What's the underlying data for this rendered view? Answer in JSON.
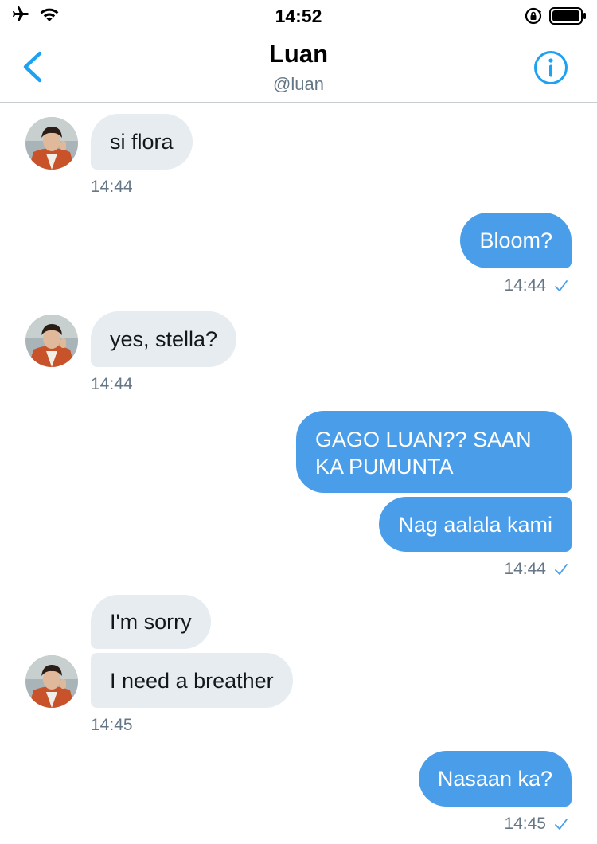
{
  "status_bar": {
    "time": "14:52"
  },
  "header": {
    "name": "Luan",
    "handle": "@luan"
  },
  "messages": [
    {
      "side": "received",
      "text": "si flora",
      "time": "14:44"
    },
    {
      "side": "sent",
      "text": "Bloom?",
      "time": "14:44"
    },
    {
      "side": "received",
      "text": "yes, stella?",
      "time": "14:44"
    },
    {
      "side": "sent",
      "text": "GAGO LUAN?? SAAN KA PUMUNTA"
    },
    {
      "side": "sent",
      "text": "Nag aalala kami",
      "time": "14:44"
    },
    {
      "side": "received",
      "text": "I'm sorry"
    },
    {
      "side": "received",
      "text": "I need a breather",
      "time": "14:45"
    },
    {
      "side": "sent",
      "text": "Nasaan ka?",
      "time": "14:45"
    }
  ],
  "icons": {
    "airplane": "airplane-icon",
    "wifi": "wifi-icon",
    "rotation_lock": "rotation-lock-icon",
    "battery": "battery-icon",
    "back": "chevron-left-icon",
    "info": "info-icon",
    "read_receipt": "checkmark-icon"
  },
  "colors": {
    "accent": "#1da1f2",
    "sent_bubble": "#4a9ee9",
    "received_bubble": "#e6ecf0",
    "timestamp": "#657786"
  }
}
